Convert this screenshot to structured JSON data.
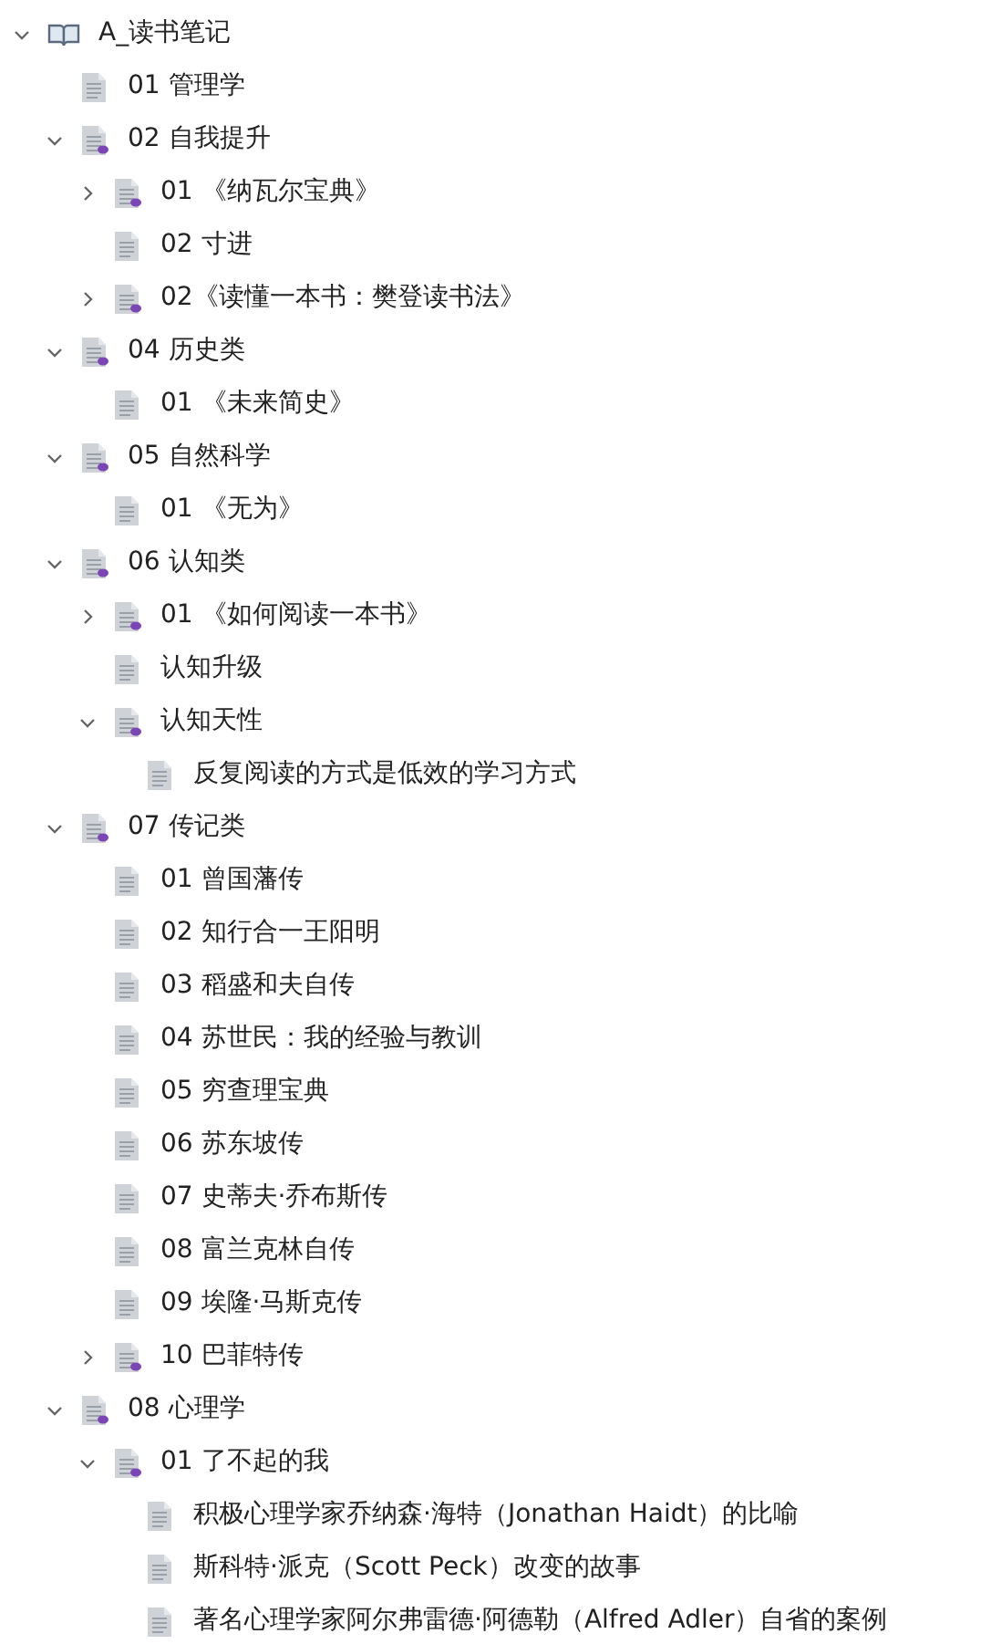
{
  "tree": [
    {
      "label": "A_读书笔记",
      "kind": "book",
      "expanded": true,
      "children": [
        {
          "label": "01 管理学",
          "kind": "page"
        },
        {
          "label": "02 自我提升",
          "kind": "folder-page",
          "expanded": true,
          "children": [
            {
              "label": "01 《纳瓦尔宝典》",
              "kind": "folder-page",
              "expanded": false
            },
            {
              "label": "02 寸进",
              "kind": "page"
            },
            {
              "label": "02《读懂一本书：樊登读书法》",
              "kind": "folder-page",
              "expanded": false
            }
          ]
        },
        {
          "label": "04 历史类",
          "kind": "folder-page",
          "expanded": true,
          "children": [
            {
              "label": "01 《未来简史》",
              "kind": "page"
            }
          ]
        },
        {
          "label": "05 自然科学",
          "kind": "folder-page",
          "expanded": true,
          "children": [
            {
              "label": "01 《无为》",
              "kind": "page"
            }
          ]
        },
        {
          "label": "06 认知类",
          "kind": "folder-page",
          "expanded": true,
          "children": [
            {
              "label": "01 《如何阅读一本书》",
              "kind": "folder-page",
              "expanded": false
            },
            {
              "label": "认知升级",
              "kind": "page"
            },
            {
              "label": "认知天性",
              "kind": "folder-page",
              "expanded": true,
              "children": [
                {
                  "label": "反复阅读的方式是低效的学习方式",
                  "kind": "page"
                }
              ]
            }
          ]
        },
        {
          "label": "07 传记类",
          "kind": "folder-page",
          "expanded": true,
          "children": [
            {
              "label": "01 曾国藩传",
              "kind": "page"
            },
            {
              "label": "02 知行合一王阳明",
              "kind": "page"
            },
            {
              "label": "03 稻盛和夫自传",
              "kind": "page"
            },
            {
              "label": "04 苏世民：我的经验与教训",
              "kind": "page"
            },
            {
              "label": "05 穷查理宝典",
              "kind": "page"
            },
            {
              "label": "06 苏东坡传",
              "kind": "page"
            },
            {
              "label": "07 史蒂夫·乔布斯传",
              "kind": "page"
            },
            {
              "label": "08 富兰克林自传",
              "kind": "page"
            },
            {
              "label": "09 埃隆·马斯克传",
              "kind": "page"
            },
            {
              "label": "10 巴菲特传",
              "kind": "folder-page",
              "expanded": false
            }
          ]
        },
        {
          "label": "08 心理学",
          "kind": "folder-page",
          "expanded": true,
          "children": [
            {
              "label": "01 了不起的我",
              "kind": "folder-page",
              "expanded": true,
              "children": [
                {
                  "label": "积极心理学家乔纳森·海特（Jonathan Haidt）的比喻",
                  "kind": "page"
                },
                {
                  "label": "斯科特·派克（Scott Peck）改变的故事",
                  "kind": "page"
                },
                {
                  "label": "著名心理学家阿尔弗雷德·阿德勒（Alfred Adler）自省的案例",
                  "kind": "page"
                }
              ]
            }
          ]
        }
      ]
    }
  ]
}
